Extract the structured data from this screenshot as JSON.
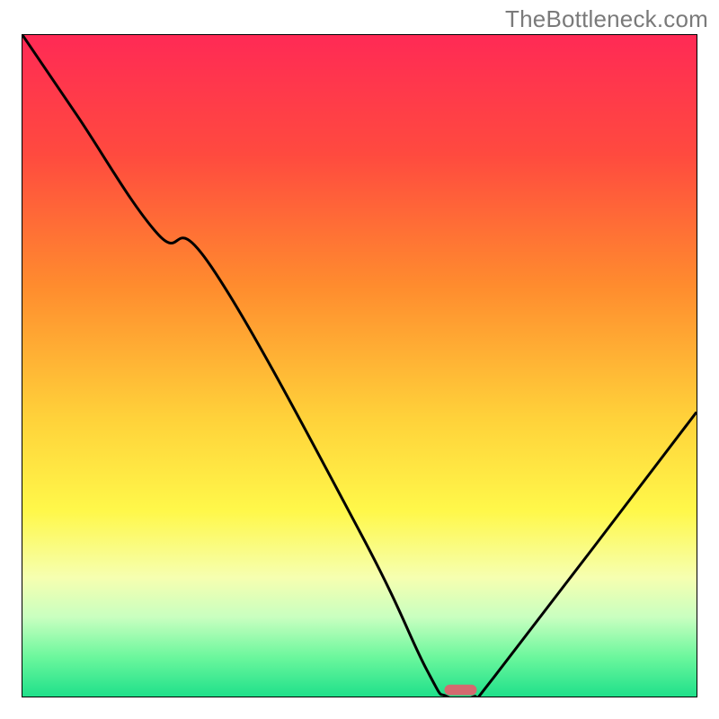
{
  "watermark": "TheBottleneck.com",
  "chart_data": {
    "type": "line",
    "title": "",
    "xlabel": "",
    "ylabel": "",
    "xlim": [
      0,
      100
    ],
    "ylim": [
      0,
      100
    ],
    "series": [
      {
        "name": "curve",
        "x": [
          0,
          8,
          20,
          28,
          50,
          60,
          63,
          67,
          70,
          100
        ],
        "y": [
          100,
          88,
          70,
          65,
          25,
          4,
          0,
          0,
          3,
          43
        ]
      }
    ],
    "marker": {
      "x": 65,
      "y": 0
    }
  },
  "gradient": {
    "stops": [
      {
        "offset": 0.0,
        "color": "#ff2a55"
      },
      {
        "offset": 0.18,
        "color": "#ff4a3f"
      },
      {
        "offset": 0.38,
        "color": "#ff8c2e"
      },
      {
        "offset": 0.58,
        "color": "#ffd23a"
      },
      {
        "offset": 0.72,
        "color": "#fff84a"
      },
      {
        "offset": 0.82,
        "color": "#f6ffb0"
      },
      {
        "offset": 0.88,
        "color": "#c9ffc0"
      },
      {
        "offset": 0.94,
        "color": "#6cf79d"
      },
      {
        "offset": 1.0,
        "color": "#1fe08a"
      }
    ]
  },
  "marker_color": "#d46a6f"
}
